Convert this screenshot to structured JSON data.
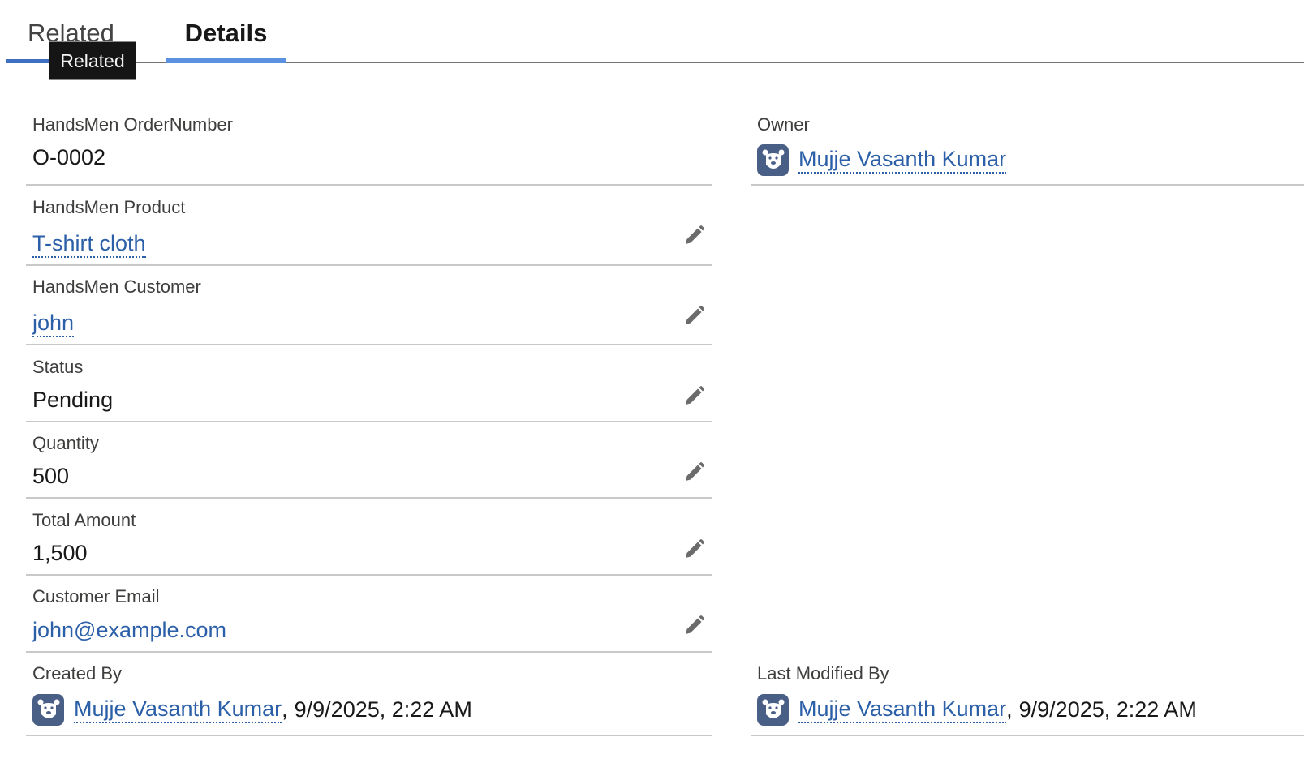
{
  "tabs": {
    "related_label": "Related",
    "details_label": "Details",
    "active": "Details",
    "tooltip": "Related"
  },
  "fields": {
    "order_number": {
      "label": "HandsMen OrderNumber",
      "value": "O-0002"
    },
    "owner": {
      "label": "Owner",
      "value": "Mujje Vasanth Kumar"
    },
    "product": {
      "label": "HandsMen Product",
      "value": "T-shirt cloth"
    },
    "customer": {
      "label": "HandsMen Customer",
      "value": "john"
    },
    "status": {
      "label": "Status",
      "value": "Pending"
    },
    "quantity": {
      "label": "Quantity",
      "value": "500"
    },
    "total_amount": {
      "label": "Total Amount",
      "value": "1,500"
    },
    "customer_email": {
      "label": "Customer Email",
      "value": "john@example.com"
    },
    "created_by": {
      "label": "Created By",
      "user": "Mujje Vasanth Kumar",
      "separator": ",",
      "date": "9/9/2025, 2:22 AM"
    },
    "last_modified_by": {
      "label": "Last Modified By",
      "user": "Mujje Vasanth Kumar",
      "separator": ",",
      "date": "9/9/2025, 2:22 AM"
    }
  },
  "icons": {
    "edit": "pencil-icon",
    "avatar": "bear-avatar-icon"
  },
  "colors": {
    "link": "#2b5fa8",
    "active_tab_indicator": "#5b91e0",
    "avatar_bg": "#4a5f86"
  }
}
